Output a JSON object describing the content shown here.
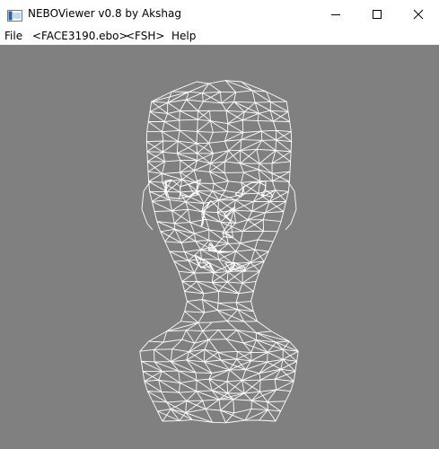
{
  "window": {
    "title": "NEBOViewer v0.8 by Akshag"
  },
  "menu": {
    "file": "File",
    "model": "<FACE3190.ebo>",
    "shader": "<FSH>",
    "help": "Help"
  },
  "icons": {
    "app": "app-icon",
    "minimize": "minimize-icon",
    "maximize": "maximize-icon",
    "close": "close-icon"
  },
  "colors": {
    "viewport_background": "#808080",
    "wireframe": "#ffffff"
  }
}
